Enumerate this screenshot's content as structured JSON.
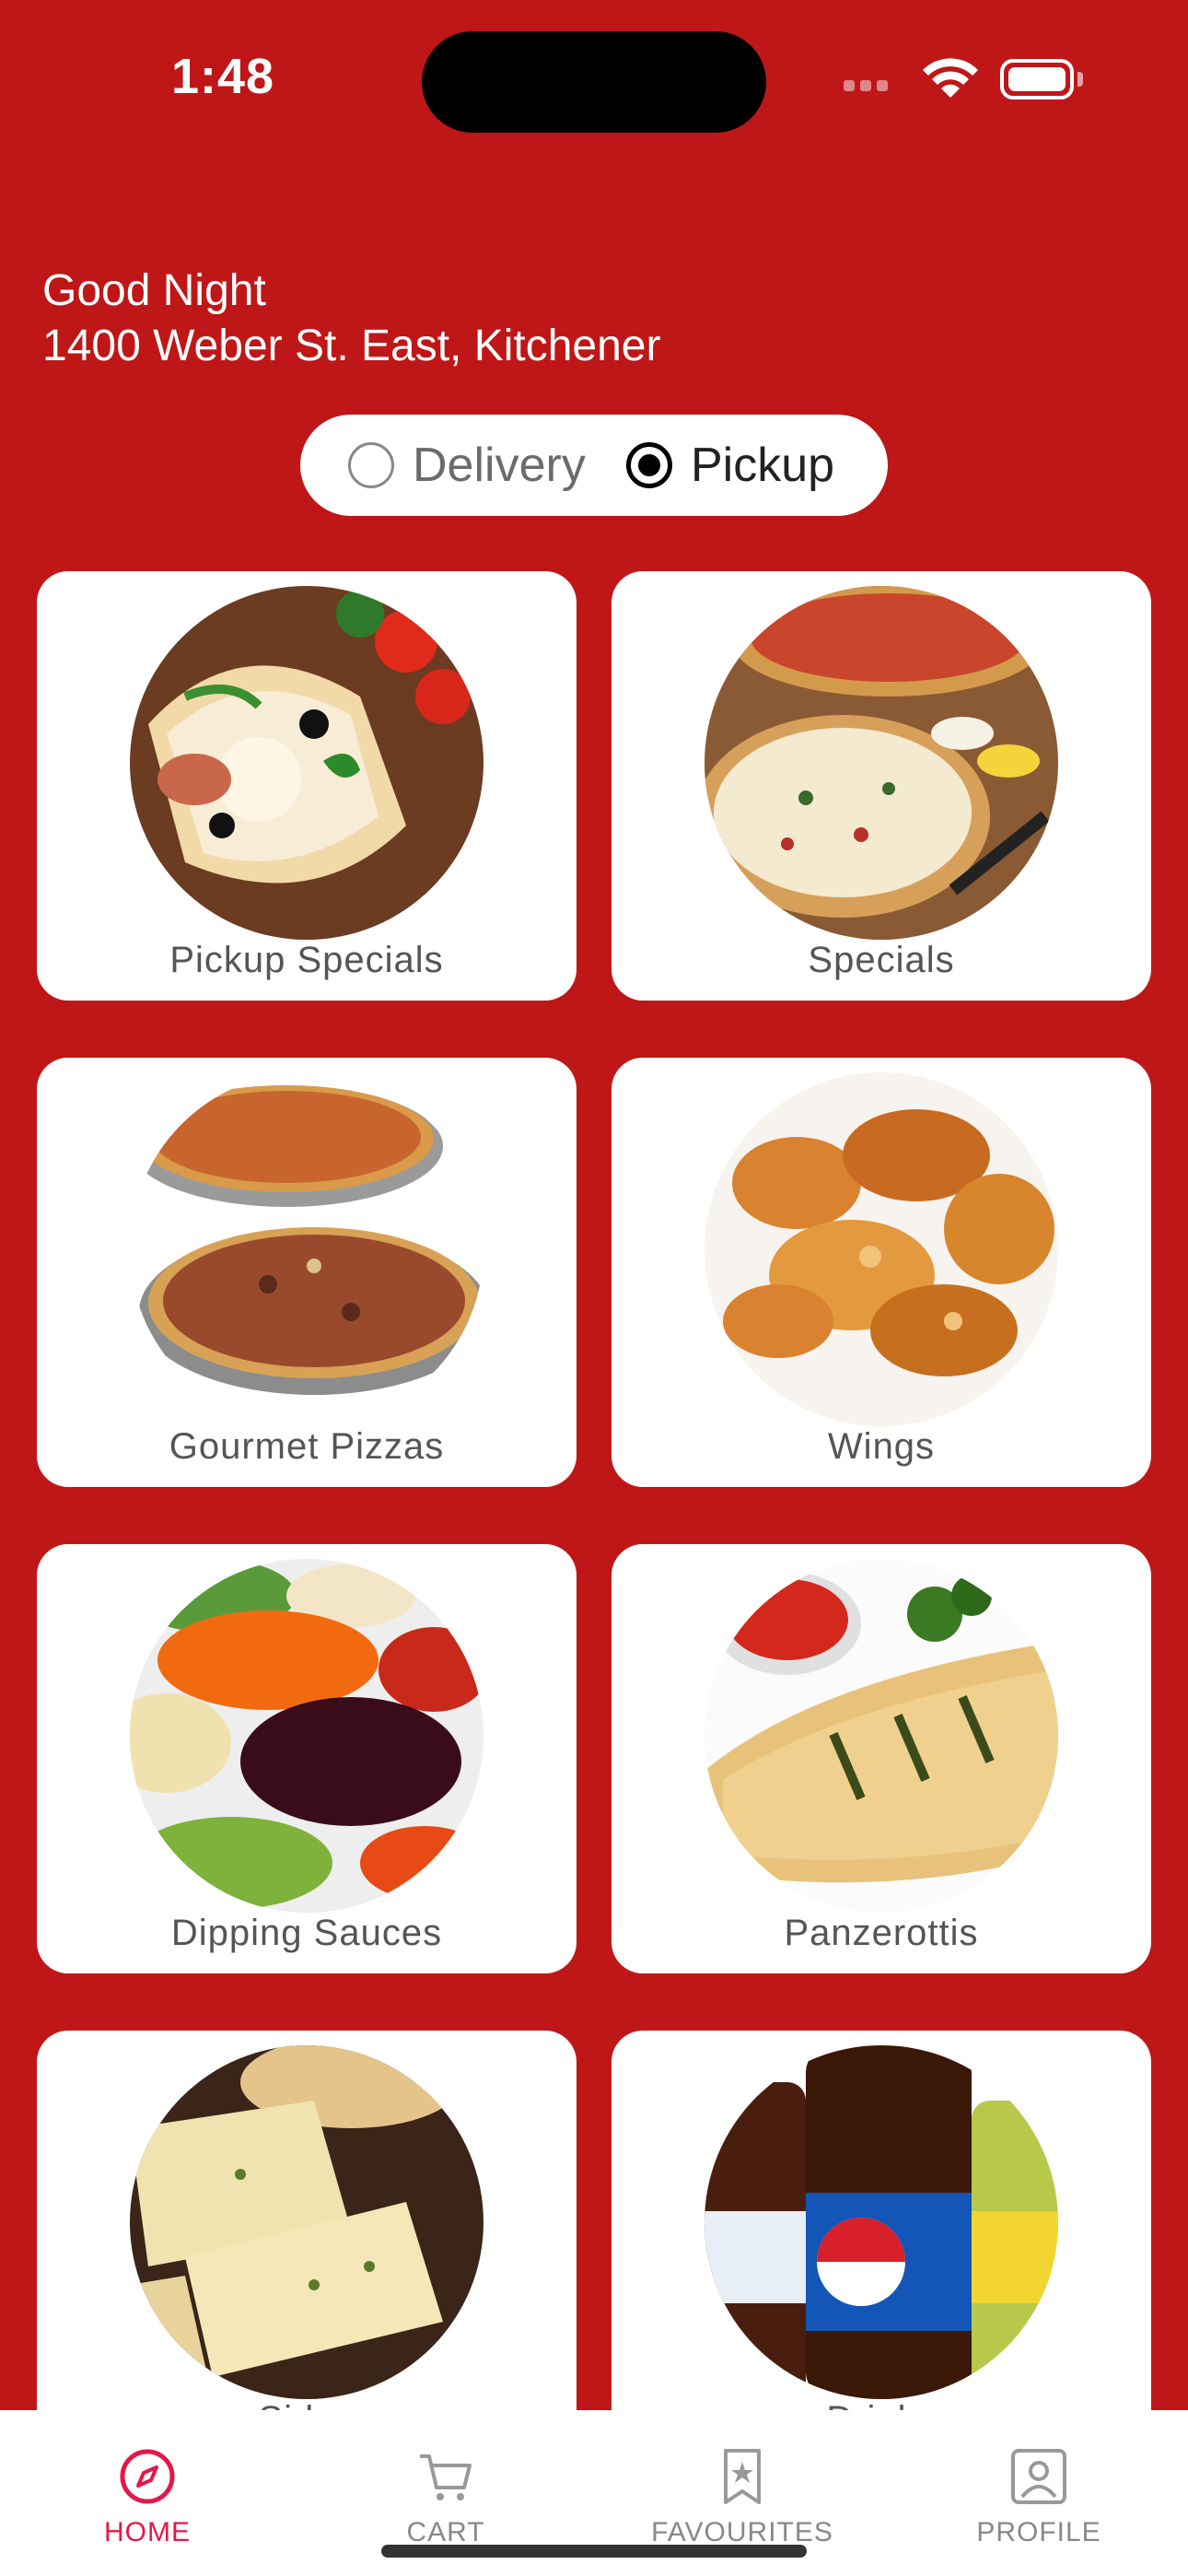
{
  "status_bar": {
    "time": "1:48"
  },
  "header": {
    "greeting": "Good Night",
    "address": "1400 Weber St. East, Kitchener"
  },
  "order_mode": {
    "options": [
      {
        "label": "Delivery",
        "selected": false
      },
      {
        "label": "Pickup",
        "selected": true
      }
    ]
  },
  "categories": [
    {
      "label": "Pickup Specials"
    },
    {
      "label": "Specials"
    },
    {
      "label": "Gourmet Pizzas"
    },
    {
      "label": "Wings"
    },
    {
      "label": "Dipping Sauces"
    },
    {
      "label": "Panzerottis"
    },
    {
      "label": "Sides"
    },
    {
      "label": "Drinks"
    }
  ],
  "tabbar": {
    "items": [
      {
        "label": "HOME",
        "icon": "compass-icon",
        "active": true
      },
      {
        "label": "CART",
        "icon": "cart-icon",
        "active": false
      },
      {
        "label": "FAVOURITES",
        "icon": "bookmark-star-icon",
        "active": false
      },
      {
        "label": "PROFILE",
        "icon": "profile-icon",
        "active": false
      }
    ]
  },
  "colors": {
    "background": "#bf1718",
    "active_tab": "#e5174a"
  }
}
